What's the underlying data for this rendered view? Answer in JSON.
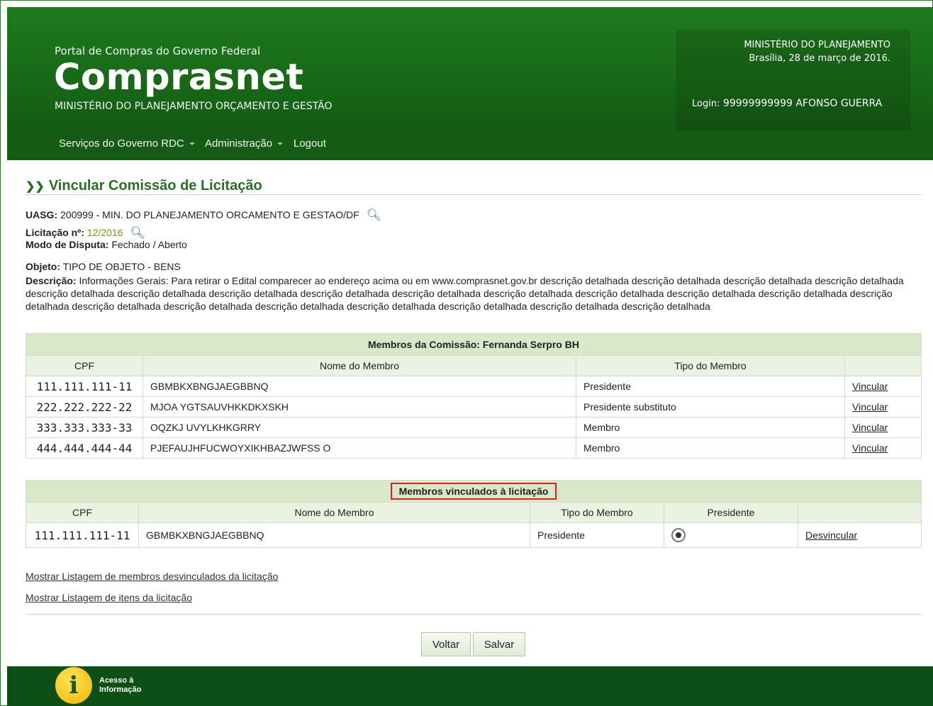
{
  "header": {
    "portal_subtitle": "Portal de Compras do Governo Federal",
    "brand": "Comprasnet",
    "ministry": "MINISTÉRIO DO PLANEJAMENTO ORÇAMENTO E GESTÃO",
    "info_ministry": "MINISTÉRIO DO PLANEJAMENTO",
    "date": "Brasília, 28 de março de 2016.",
    "login_label": "Login:",
    "login_value": "99999999999 AFONSO GUERRA"
  },
  "nav": {
    "items": [
      {
        "label": "Serviços do Governo RDC",
        "has_caret": true
      },
      {
        "label": "Administração",
        "has_caret": true
      },
      {
        "label": "Logout",
        "has_caret": false
      }
    ]
  },
  "page": {
    "title": "Vincular Comissão de Licitação",
    "uasg_label": "UASG:",
    "uasg_value": "200999 - MIN. DO PLANEJAMENTO ORCAMENTO E GESTAO/DF",
    "licitacao_label": "Licitação nº:",
    "licitacao_value": "12/2016",
    "modo_label": "Modo de Disputa:",
    "modo_value": "Fechado / Aberto",
    "objeto_label": "Objeto:",
    "objeto_value": "TIPO DE OBJETO - BENS",
    "descricao_label": "Descrição:",
    "descricao_value": "Informações Gerais: Para retirar o Edital comparecer ao endereço acima ou em www.comprasnet.gov.br descrição detalhada descrição detalhada descrição detalhada descrição detalhada descrição detalhada descrição detalhada descrição detalhada descrição detalhada descrição detalhada descrição detalhada descrição detalhada descrição detalhada descrição detalhada descrição detalhada descrição detalhada descrição detalhada descrição detalhada descrição detalhada descrição detalhada descrição detalhada descrição detalhada"
  },
  "members_table": {
    "caption": "Membros da Comissão: Fernanda Serpro BH",
    "headers": [
      "CPF",
      "Nome do Membro",
      "Tipo do Membro",
      ""
    ],
    "rows": [
      {
        "cpf": "111.111.111-11",
        "name": "GBMBKXBNGJAEGBBNQ",
        "type": "Presidente",
        "action": "Vincular"
      },
      {
        "cpf": "222.222.222-22",
        "name": "MJOA YGTSAUVHKKDKXSKH",
        "type": "Presidente substituto",
        "action": "Vincular"
      },
      {
        "cpf": "333.333.333-33",
        "name": "OQZKJ UVYLKHKGRRY",
        "type": "Membro",
        "action": "Vincular"
      },
      {
        "cpf": "444.444.444-44",
        "name": "PJEFAUJHFUCWOYXIKHBAZJWFSS O",
        "type": "Membro",
        "action": "Vincular"
      }
    ]
  },
  "linked_table": {
    "caption": "Membros vinculados à licitação",
    "headers": [
      "CPF",
      "Nome do Membro",
      "Tipo do Membro",
      "Presidente",
      ""
    ],
    "rows": [
      {
        "cpf": "111.111.111-11",
        "name": "GBMBKXBNGJAEGBBNQ",
        "type": "Presidente",
        "president_selected": true,
        "action": "Desvincular"
      }
    ]
  },
  "links": {
    "unlinked_members": "Mostrar Listagem de membros desvinculados da licitação",
    "items": "Mostrar Listagem de itens da licitação"
  },
  "buttons": {
    "back": "Voltar",
    "save": "Salvar"
  },
  "footer": {
    "acesso_line1": "Acesso à",
    "acesso_line2": "Informação"
  },
  "colors": {
    "header_green": "#1f7a1f",
    "nav_green": "#155a15",
    "title_green": "#2a6e2a",
    "caption_bg": "#d8e8c8",
    "highlight_red": "#e02020"
  }
}
